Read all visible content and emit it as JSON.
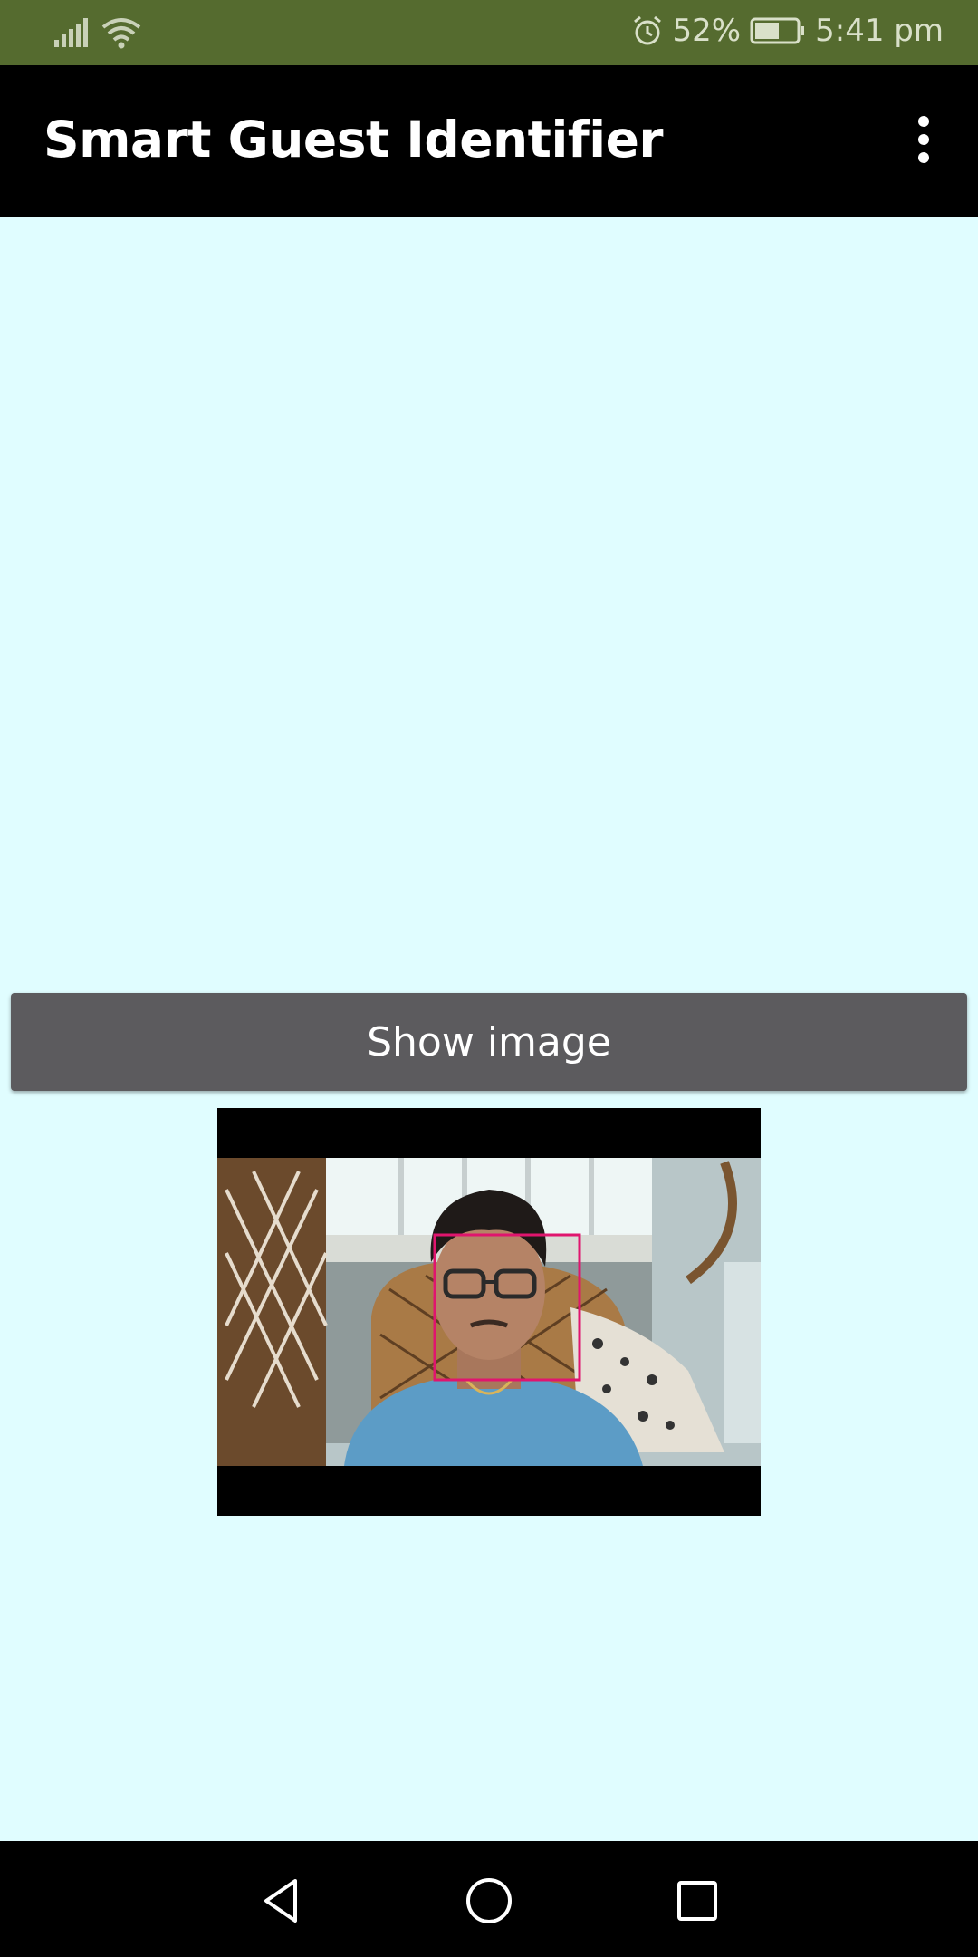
{
  "status_bar": {
    "battery_percent": "52%",
    "time": "5:41 pm",
    "icons": [
      "signal-icon",
      "wifi-icon",
      "alarm-icon",
      "battery-icon"
    ]
  },
  "app_bar": {
    "title": "Smart Guest Identifier",
    "menu_icon": "overflow-menu-icon"
  },
  "main": {
    "show_image_button": "Show image",
    "image": {
      "description_icon": "camera-photo",
      "face_detected": true,
      "face_box_color": "#e0156e"
    }
  },
  "nav_bar": {
    "icons": [
      "back-icon",
      "home-icon",
      "recents-icon"
    ]
  },
  "colors": {
    "status_bar": "#556b2f",
    "app_bar": "#000000",
    "background": "#e0fdff",
    "button": "#5c5b5e"
  }
}
